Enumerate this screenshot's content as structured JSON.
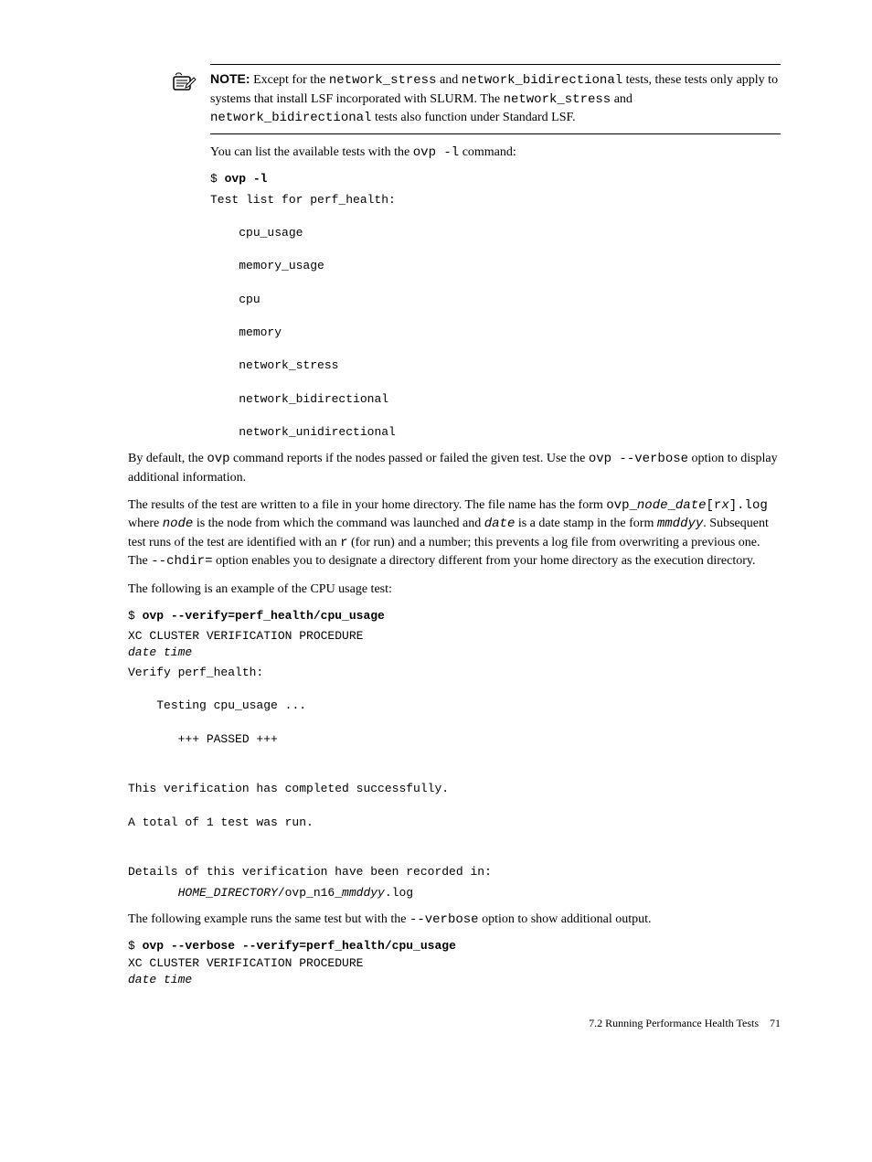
{
  "note": {
    "label": "NOTE:",
    "text_prefix": "Except for the ",
    "code1": "network_stress",
    "text_mid1": " and ",
    "code2": "network_bidirectional",
    "text_after1": " tests, these tests only apply to systems that install LSF incorporated with SLURM. The ",
    "code3": "network_stress",
    "text_mid2": " and ",
    "code4": "network_bidirectional",
    "text_after2": " tests also function under Standard LSF."
  },
  "line1": {
    "text1": "You can list the available tests with the ",
    "code1": "ovp  -l",
    "text2": " command:"
  },
  "cmd1": "$ ",
  "cmd1_bold": "ovp -l",
  "testlist": "Test list for perf_health:\n\n    cpu_usage\n\n    memory_usage\n\n    cpu\n\n    memory\n\n    network_stress\n\n    network_bidirectional\n\n    network_unidirectional",
  "para2": {
    "t1": "By default, the ",
    "c1": "ovp",
    "t2": " command reports if the nodes passed or failed the given test. Use the ",
    "c2": "ovp --verbose",
    "t3": " option to display additional information."
  },
  "para3": {
    "t1": "The results of the test are written to a file in your home directory. The file name has the form ",
    "c1": "ovp_",
    "ci1": "node",
    "c1b": "_",
    "ci2": "date",
    "c2": "[r",
    "ci3": "x",
    "c3": "].log",
    "t2": " where ",
    "ci4": "node",
    "t3": " is the node from which the command was launched and ",
    "ci5": "date",
    "t4": " is a date stamp in the form ",
    "ci6": "mmddyy",
    "t5": ". Subsequent test runs of the test are identified with an ",
    "c4": "r",
    "t6": " (for run) and a number; this prevents a log file from overwriting a previous one. The ",
    "c5": "--chdir=",
    "t7": " option enables you to designate a directory different from your home directory as the execution directory."
  },
  "para4": "The following is an example of the CPU usage test:",
  "cmd2_prefix": "$ ",
  "cmd2_bold": "ovp --verify=perf_health/cpu_usage",
  "out2_line1": "XC CLUSTER VERIFICATION PROCEDURE",
  "out2_line2_italic": "date time",
  "out2_block": "Verify perf_health:\n\n    Testing cpu_usage ...\n\n       +++ PASSED +++\n\n\nThis verification has completed successfully.\n\nA total of 1 test was run.\n\n\nDetails of this verification have been recorded in:",
  "out2_path_prefix": "       ",
  "out2_path_italic1": "HOME_DIRECTORY",
  "out2_path_mid": "/ovp_n16_",
  "out2_path_italic2": "mmddyy",
  "out2_path_suffix": ".log",
  "para5": {
    "t1": "The following example runs the same test but with the ",
    "c1": "--verbose",
    "t2": " option to show additional output."
  },
  "cmd3_prefix": "$ ",
  "cmd3_bold": "ovp --verbose --verify=perf_health/cpu_usage",
  "out3_line1": "XC CLUSTER VERIFICATION PROCEDURE",
  "out3_line2_italic": "date time",
  "footer": {
    "section": "7.2 Running Performance Health Tests",
    "page": "71"
  }
}
